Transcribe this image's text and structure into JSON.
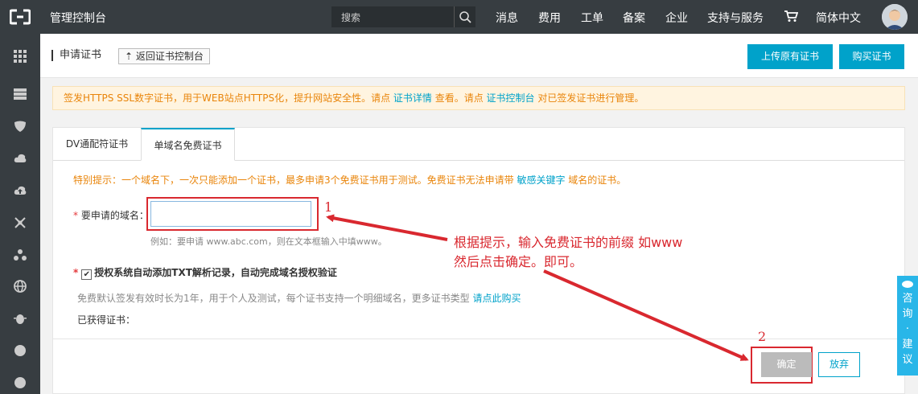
{
  "topbar": {
    "console_title": "管理控制台",
    "search_placeholder": "搜索",
    "nav": [
      "消息",
      "费用",
      "工单",
      "备案",
      "企业",
      "支持与服务",
      "简体中文"
    ]
  },
  "header": {
    "page_title": "申请证书",
    "back_label": "返回证书控制台",
    "upload_label": "上传原有证书",
    "buy_label": "购买证书"
  },
  "notice": {
    "text1": "签发HTTPS SSL数字证书，用于WEB站点HTTPS化，提升网站安全性。请点 ",
    "link1": "证书详情",
    "text2": " 查看。请点 ",
    "link2": "证书控制台",
    "text3": " 对已签发证书进行管理。"
  },
  "tabs": [
    "DV通配符证书",
    "单域名免费证书"
  ],
  "form": {
    "tip_text": "特别提示：一个域名下，一次只能添加一个证书，最多申请3个免费证书用于测试。免费证书无法申请带 ",
    "tip_link": "敏感关键字",
    "tip_tail": " 域名的证书。",
    "domain_label": "要申请的域名：",
    "domain_required": "*",
    "domain_value": "",
    "example": "例如：要申请 www.abc.com，则在文本框输入中填www。",
    "checkbox_label": "授权系统自动添加TXT解析记录，自动完成域名授权验证",
    "checkbox_required": "*",
    "info_text": "免费默认签发有效时长为1年，用于个人及测试，每个证书支持一个明细域名，更多证书类型 ",
    "info_link": "请点此购买",
    "obtained_label": "已获得证书：",
    "confirm_label": "确定",
    "cancel_label": "放弃"
  },
  "annotations": {
    "num1": "1",
    "num2": "2",
    "line1": "根据提示，输入免费证书的前缀  如www",
    "line2": "然后点击确定。即可。",
    "color": "#d9282f"
  },
  "consult": [
    "咨",
    "询",
    "·",
    "建",
    "议"
  ],
  "colors": {
    "accent": "#00a2ca",
    "topbar": "#373d41",
    "warning": "#e9850b"
  }
}
